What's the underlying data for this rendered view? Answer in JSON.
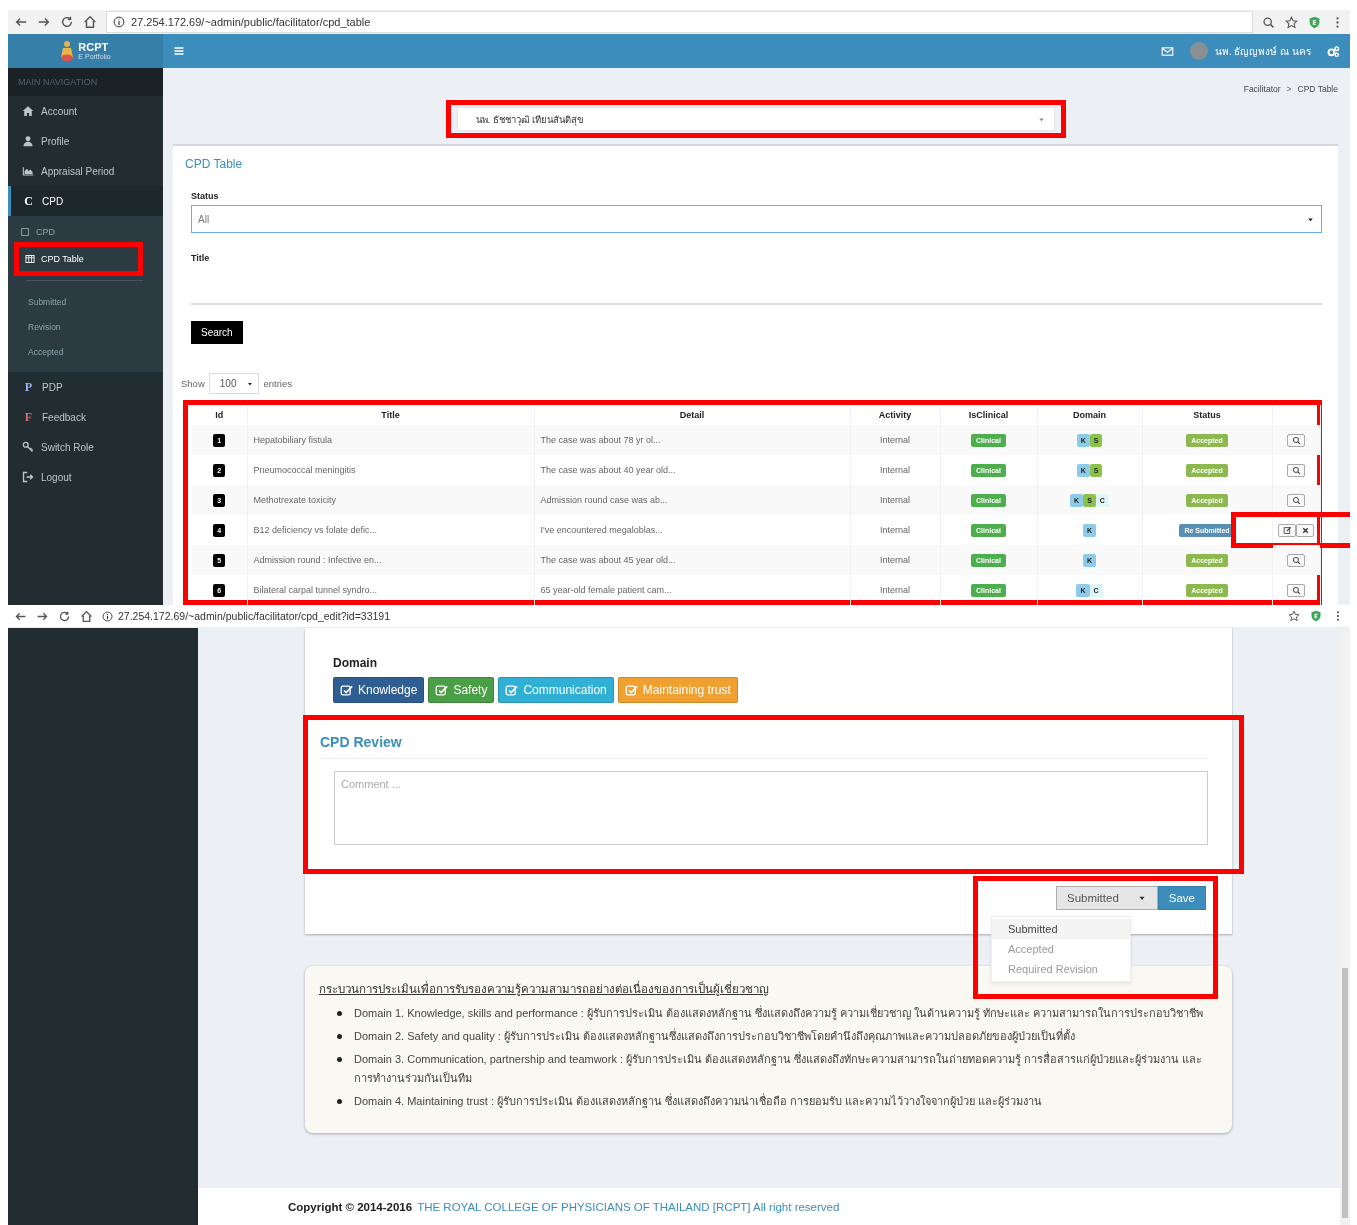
{
  "list_window": {
    "address": "27.254.172.69/~admin/public/facilitator/cpd_table",
    "brand": {
      "name": "RCPT",
      "subtitle": "E Portfolio"
    },
    "user_name": "นพ. ธัญญพงษ์ ณ นคร",
    "sidebar": {
      "header": "MAIN NAVIGATION",
      "items": [
        {
          "label": "Account",
          "selected": false
        },
        {
          "label": "Profile",
          "selected": false
        },
        {
          "label": "Appraisal Period",
          "selected": false
        },
        {
          "label": "CPD",
          "glyph": "C",
          "selected": true,
          "expanded": true,
          "children": [
            {
              "label": "CPD",
              "selected": false,
              "highlighted": false
            },
            {
              "label": "CPD Table",
              "selected": true,
              "highlighted": true,
              "children": [
                {
                  "label": "Submitted",
                  "selected": false
                },
                {
                  "label": "Revision",
                  "selected": false
                },
                {
                  "label": "Accepted",
                  "selected": false
                }
              ]
            }
          ]
        },
        {
          "label": "PDP",
          "glyph": "P",
          "selected": false
        },
        {
          "label": "Feedback",
          "glyph": "F",
          "selected": false
        },
        {
          "label": "Switch Role",
          "selected": false
        },
        {
          "label": "Logout",
          "selected": false
        }
      ]
    },
    "breadcrumb": [
      "Facilitator",
      "CPD Table"
    ],
    "breadcrumb_separator": ">",
    "person_select": {
      "value": "นพ. ธัชชาวุฒิ เทียนสันติสุข",
      "highlighted": true
    },
    "panel": {
      "title": "CPD Table",
      "status_label": "Status",
      "status_value": "All",
      "title_label": "Title",
      "search_button": "Search",
      "show_label": "Show",
      "entries_value": "100",
      "entries_label": "entries"
    },
    "table": {
      "highlighted": true,
      "columns": [
        "Id",
        "Title",
        "Detail",
        "Activity",
        "IsClinical",
        "Domain",
        "Status"
      ],
      "rows": [
        {
          "id": "1",
          "title": "Hepatobiliary fistula",
          "detail": "The case was about 78 yr ol...",
          "activity": "Internal",
          "clinical": "Clinical",
          "domains": [
            {
              "code": "K",
              "color": "#8ccbe9"
            },
            {
              "code": "S",
              "color": "#8bc34a"
            }
          ],
          "status": {
            "label": "Accepted",
            "color": "#8cb84f"
          },
          "actions": [
            {
              "kind": "view"
            }
          ],
          "actions_highlighted": false
        },
        {
          "id": "2",
          "title": "Pneumococcal meningitis",
          "detail": "The case was about 40 year old...",
          "activity": "Internal",
          "clinical": "Clinical",
          "domains": [
            {
              "code": "K",
              "color": "#8ccbe9"
            },
            {
              "code": "S",
              "color": "#8bc34a"
            }
          ],
          "status": {
            "label": "Accepted",
            "color": "#8cb84f"
          },
          "actions": [
            {
              "kind": "view"
            }
          ],
          "actions_highlighted": false
        },
        {
          "id": "3",
          "title": "Methotrexate toxicity",
          "detail": "Admission round case was ab...",
          "activity": "Internal",
          "clinical": "Clinical",
          "domains": [
            {
              "code": "K",
              "color": "#8ccbe9"
            },
            {
              "code": "S",
              "color": "#8bc34a"
            },
            {
              "code": "C",
              "color": "#e0f7fa"
            }
          ],
          "status": {
            "label": "Accepted",
            "color": "#8cb84f"
          },
          "actions": [
            {
              "kind": "view"
            }
          ],
          "actions_highlighted": false
        },
        {
          "id": "4",
          "title": "B12 deficiency vs folate defic...",
          "detail": "I've encountered megaloblas...",
          "activity": "Internal",
          "clinical": "Clinical",
          "domains": [
            {
              "code": "K",
              "color": "#8ccbe9"
            }
          ],
          "status": {
            "label": "Re Submitted",
            "color": "#5a8fb5"
          },
          "actions": [
            {
              "kind": "edit"
            },
            {
              "kind": "delete"
            }
          ],
          "actions_highlighted": true
        },
        {
          "id": "5",
          "title": "Admission round : Infective en...",
          "detail": "The case was about 45 year old...",
          "activity": "Internal",
          "clinical": "Clinical",
          "domains": [
            {
              "code": "K",
              "color": "#8ccbe9"
            }
          ],
          "status": {
            "label": "Accepted",
            "color": "#8cb84f"
          },
          "actions": [
            {
              "kind": "view"
            }
          ],
          "actions_highlighted": false
        },
        {
          "id": "6",
          "title": "Bilateral carpal tunnel syndro...",
          "detail": "65 year-old female patient cam...",
          "activity": "Internal",
          "clinical": "Clinical",
          "domains": [
            {
              "code": "K",
              "color": "#8ccbe9"
            },
            {
              "code": "C",
              "color": "#e0f7fa"
            }
          ],
          "status": {
            "label": "Accepted",
            "color": "#8cb84f"
          },
          "actions": [
            {
              "kind": "view"
            }
          ],
          "actions_highlighted": false
        }
      ]
    }
  },
  "edit_window": {
    "address": "27.254.172.69/~admin/public/facilitator/cpd_edit?id=33191",
    "domain_label": "Domain",
    "domains": [
      {
        "label": "Knowledge",
        "checked": true,
        "color": "#2f5f92"
      },
      {
        "label": "Safety",
        "checked": true,
        "color": "#4a9e45"
      },
      {
        "label": "Communication",
        "checked": true,
        "color": "#31b0d5"
      },
      {
        "label": "Maintaining trust",
        "checked": true,
        "color": "#f0a030"
      }
    ],
    "review": {
      "title": "CPD Review",
      "placeholder": "Comment ...",
      "highlighted": true
    },
    "status_dropdown": {
      "value": "Submitted",
      "expanded": true,
      "highlighted": true,
      "options": [
        {
          "label": "Submitted",
          "selected": true
        },
        {
          "label": "Accepted",
          "selected": false
        },
        {
          "label": "Required Revision",
          "selected": false
        }
      ]
    },
    "save_button": "Save",
    "guide": {
      "heading": "กระบวนการประเมินเพื่อการรับรองความรู้ความสามารถอย่างต่อเนื่องของการเป็นผู้เชี่ยวชาญ",
      "items": [
        "Domain 1. Knowledge, skills and performance : ผู้รับการประเมิน ต้องแสดงหลักฐาน ซึ่งแสดงถึงความรู้ ความเชี่ยวชาญ ในด้านความรู้ ทักษะและ ความสามารถในการประกอบวิชาชีพ",
        "Domain 2. Safety and quality : ผู้รับการประเมิน ต้องแสดงหลักฐานซึ่งแสดงถึงการประกอบวิชาชีพโดยคำนึงถึงคุณภาพและความปลอดภัยของผู้ป่วยเป็นที่ตั้ง",
        "Domain 3. Communication, partnership and teamwork : ผู้รับการประเมิน ต้องแสดงหลักฐาน ซึ่งแสดงถึงทักษะความสามารถในถ่ายทอดความรู้ การสื่อสารแก่ผู้ป่วยและผู้ร่วมงาน และการทำงานร่วมกันเป็นทีม",
        "Domain 4. Maintaining trust : ผู้รับการประเมิน ต้องแสดงหลักฐาน ซึ่งแสดงถึงความน่าเชื่อถือ การยอมรับ และความไว้วางใจจากผู้ป่วย และผู้ร่วมงาน"
      ]
    },
    "footer": {
      "copyright": "Copyright © 2014-2016",
      "link": "THE ROYAL COLLEGE OF PHYSICIANS OF THAILAND [RCPT] All right reserved"
    }
  }
}
